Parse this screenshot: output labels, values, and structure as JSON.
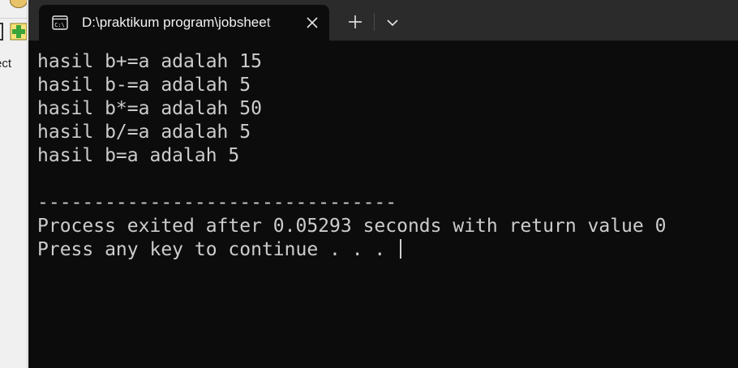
{
  "background_app": {
    "partial_text": "ect"
  },
  "terminal": {
    "tab": {
      "icon": "cmd-icon",
      "title": "D:\\praktikum program\\jobsheet",
      "close_icon": "close-icon"
    },
    "toolbar": {
      "new_tab_icon": "plus-icon",
      "dropdown_icon": "chevron-down-icon"
    },
    "output": {
      "lines": [
        "hasil b+=a adalah 15",
        "hasil b-=a adalah 5",
        "hasil b*=a adalah 50",
        "hasil b/=a adalah 5",
        "hasil b=a adalah 5",
        "",
        "--------------------------------",
        "Process exited after 0.05293 seconds with return value 0",
        "Press any key to continue . . . "
      ]
    }
  },
  "colors": {
    "terminal_bg": "#0c0c0c",
    "titlebar_bg": "#2b2b2b",
    "text": "#cccccc"
  }
}
